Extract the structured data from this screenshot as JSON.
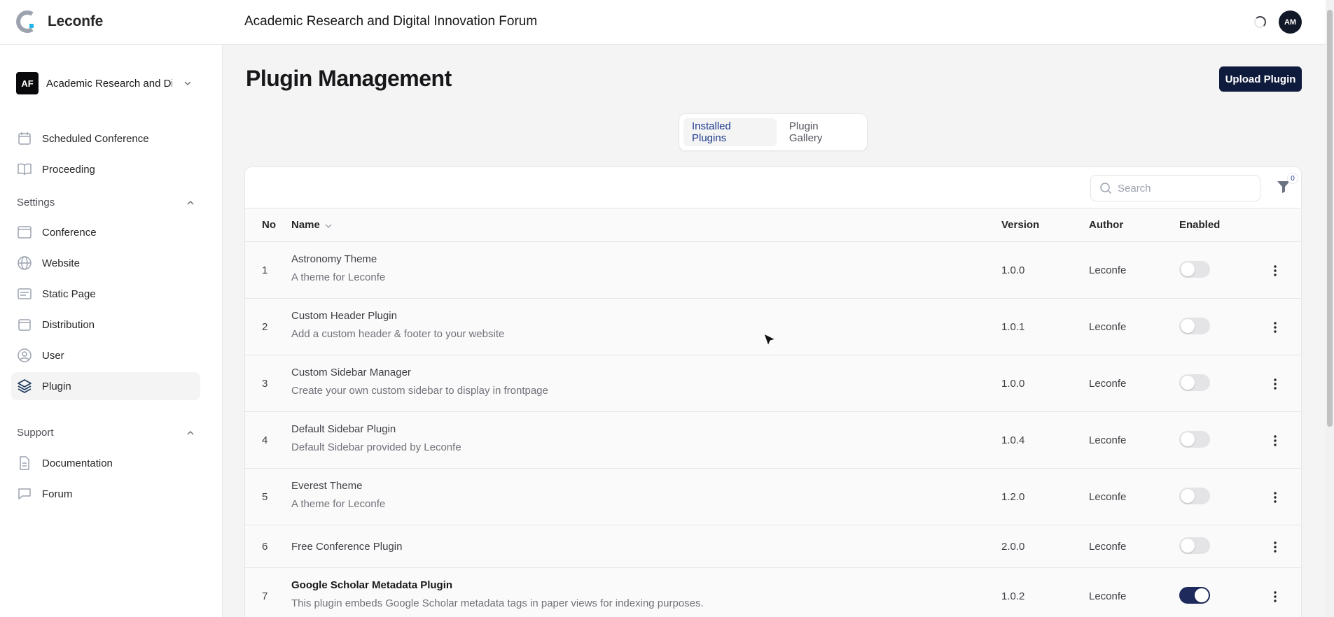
{
  "brand": {
    "name": "Leconfe"
  },
  "header": {
    "conference_title": "Academic Research and Digital Innovation Forum",
    "avatar_initials": "AM"
  },
  "sidebar": {
    "conference": {
      "badge": "AF",
      "name": "Academic Research and Digital Innovation Forum"
    },
    "items": [
      {
        "label": "Scheduled Conference",
        "icon": "calendar-icon"
      },
      {
        "label": "Proceeding",
        "icon": "book-icon"
      }
    ],
    "settings": {
      "title": "Settings",
      "items": [
        {
          "label": "Conference",
          "icon": "window-icon"
        },
        {
          "label": "Website",
          "icon": "globe-icon"
        },
        {
          "label": "Static Page",
          "icon": "page-icon"
        },
        {
          "label": "Distribution",
          "icon": "calendar-icon"
        },
        {
          "label": "User",
          "icon": "user-icon"
        },
        {
          "label": "Plugin",
          "icon": "layers-icon",
          "active": true
        }
      ]
    },
    "support": {
      "title": "Support",
      "items": [
        {
          "label": "Documentation",
          "icon": "document-icon"
        },
        {
          "label": "Forum",
          "icon": "chat-icon"
        }
      ]
    }
  },
  "main": {
    "title": "Plugin Management",
    "upload_label": "Upload Plugin",
    "tabs": [
      {
        "label": "Installed Plugins",
        "active": true
      },
      {
        "label": "Plugin Gallery",
        "active": false
      }
    ],
    "search_placeholder": "Search",
    "filter_count": "0",
    "columns": {
      "no": "No",
      "name": "Name",
      "version": "Version",
      "author": "Author",
      "enabled": "Enabled"
    },
    "rows": [
      {
        "no": "1",
        "name": "Astronomy Theme",
        "description": "A theme for Leconfe",
        "version": "1.0.0",
        "author": "Leconfe",
        "enabled": false
      },
      {
        "no": "2",
        "name": "Custom Header Plugin",
        "description": "Add a custom header & footer to your website",
        "version": "1.0.1",
        "author": "Leconfe",
        "enabled": false
      },
      {
        "no": "3",
        "name": "Custom Sidebar Manager",
        "description": "Create your own custom sidebar to display in frontpage",
        "version": "1.0.0",
        "author": "Leconfe",
        "enabled": false
      },
      {
        "no": "4",
        "name": "Default Sidebar Plugin",
        "description": "Default Sidebar provided by Leconfe",
        "version": "1.0.4",
        "author": "Leconfe",
        "enabled": false
      },
      {
        "no": "5",
        "name": "Everest Theme",
        "description": "A theme for Leconfe",
        "version": "1.2.0",
        "author": "Leconfe",
        "enabled": false
      },
      {
        "no": "6",
        "name": "Free Conference Plugin",
        "description": "",
        "version": "2.0.0",
        "author": "Leconfe",
        "enabled": false
      },
      {
        "no": "7",
        "name": "Google Scholar Metadata Plugin",
        "description": "This plugin embeds Google Scholar metadata tags in paper views for indexing purposes.",
        "version": "1.0.2",
        "author": "Leconfe",
        "enabled": true
      }
    ]
  },
  "colors": {
    "primary": "#0f1b3d",
    "toggle_on": "#1e2a5c",
    "active_tab_text": "#1e3a8a"
  }
}
